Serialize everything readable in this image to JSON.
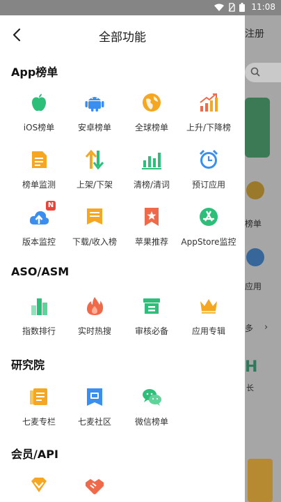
{
  "status_bar": {
    "time": "11:08"
  },
  "background_app": {
    "register": "注册",
    "hot_label": "榜单",
    "app_label": "应用",
    "more": "多",
    "banner_letters": "H",
    "long_text": "长"
  },
  "header": {
    "title": "全部功能"
  },
  "sections": [
    {
      "title": "App榜单",
      "items": [
        {
          "label": "iOS榜单",
          "icon": "apple-icon"
        },
        {
          "label": "安卓榜单",
          "icon": "android-icon"
        },
        {
          "label": "全球榜单",
          "icon": "globe-icon"
        },
        {
          "label": "上升/下降榜",
          "icon": "trend-icon"
        },
        {
          "label": "榜单监测",
          "icon": "document-icon"
        },
        {
          "label": "上架/下架",
          "icon": "up-down-arrows-icon"
        },
        {
          "label": "清榜/清词",
          "icon": "bar-chart-icon"
        },
        {
          "label": "预订应用",
          "icon": "alarm-clock-icon"
        },
        {
          "label": "版本监控",
          "icon": "cloud-upload-icon",
          "badge": "N"
        },
        {
          "label": "下载/收入榜",
          "icon": "download-list-icon"
        },
        {
          "label": "苹果推荐",
          "icon": "bookmark-star-icon"
        },
        {
          "label": "AppStore监控",
          "icon": "appstore-icon"
        }
      ]
    },
    {
      "title": "ASO/ASM",
      "items": [
        {
          "label": "指数排行",
          "icon": "index-bars-icon"
        },
        {
          "label": "实时热搜",
          "icon": "flame-icon"
        },
        {
          "label": "审核必备",
          "icon": "archive-box-icon"
        },
        {
          "label": "应用专辑",
          "icon": "crown-icon"
        }
      ]
    },
    {
      "title": "研究院",
      "items": [
        {
          "label": "七麦专栏",
          "icon": "column-doc-icon"
        },
        {
          "label": "七麦社区",
          "icon": "community-icon"
        },
        {
          "label": "微信榜单",
          "icon": "wechat-icon"
        }
      ]
    },
    {
      "title": "会员/API",
      "items": [
        {
          "label": "",
          "icon": "diamond-icon"
        },
        {
          "label": "",
          "icon": "handshake-icon"
        }
      ]
    }
  ],
  "colors": {
    "green": "#2dbf7a",
    "blue": "#3a8ef0",
    "orange": "#f5a623",
    "red": "#f06a4a"
  }
}
